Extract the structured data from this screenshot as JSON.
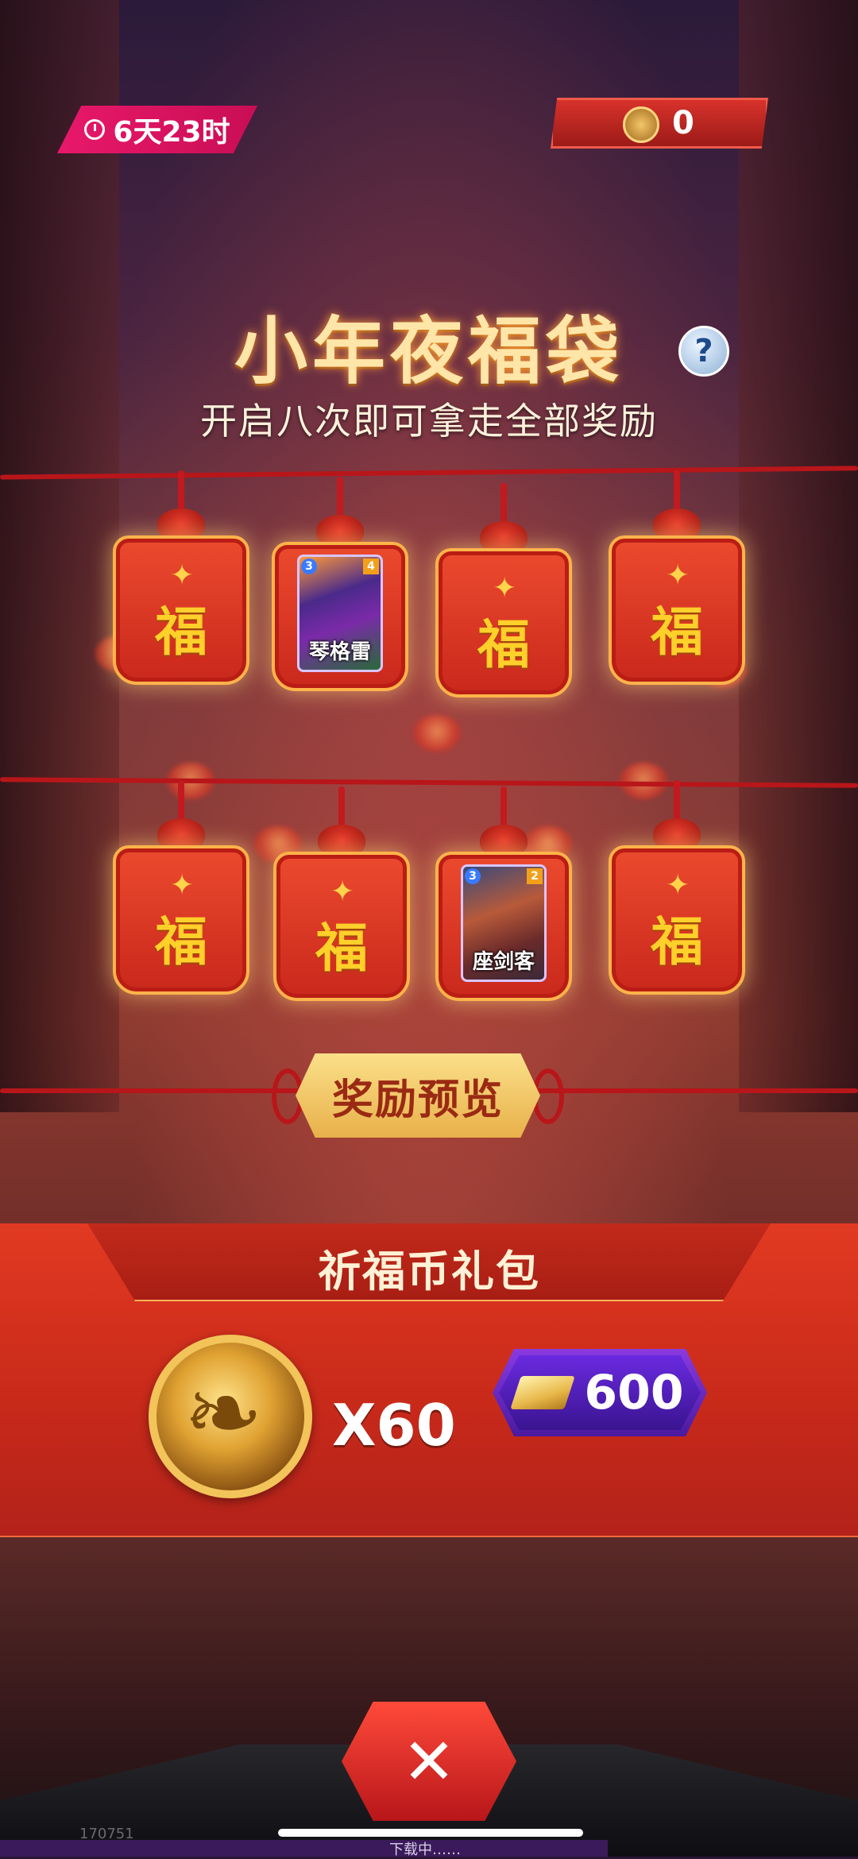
{
  "hud": {
    "timer_text": "6天23时",
    "coin_count": "0"
  },
  "event": {
    "title": "小年夜福袋",
    "help_label": "?",
    "subtitle": "开启八次即可拿走全部奖励"
  },
  "bags": [
    {
      "type": "closed",
      "label": "福"
    },
    {
      "type": "card",
      "card": {
        "name": "琴格雷",
        "cost": "3",
        "power": "4"
      }
    },
    {
      "type": "closed",
      "label": "福"
    },
    {
      "type": "closed",
      "label": "福"
    },
    {
      "type": "closed",
      "label": "福"
    },
    {
      "type": "closed",
      "label": "福"
    },
    {
      "type": "card",
      "card": {
        "name": "座剑客",
        "cost": "3",
        "power": "2"
      }
    },
    {
      "type": "closed",
      "label": "福"
    }
  ],
  "preview_button": "奖励预览",
  "gift_pack": {
    "title": "祈福币礼包",
    "quantity": "X60",
    "price": "600",
    "currency_icon": "gold-bar-icon"
  },
  "bottom": {
    "close_label": "✕",
    "build_number": "170751",
    "download_status": "下载中……"
  },
  "colors": {
    "accent_pink": "#e8186a",
    "bag_red": "#ec4a2e",
    "gold_text": "#ffd02a",
    "price_purple": "#6a2ae0"
  }
}
